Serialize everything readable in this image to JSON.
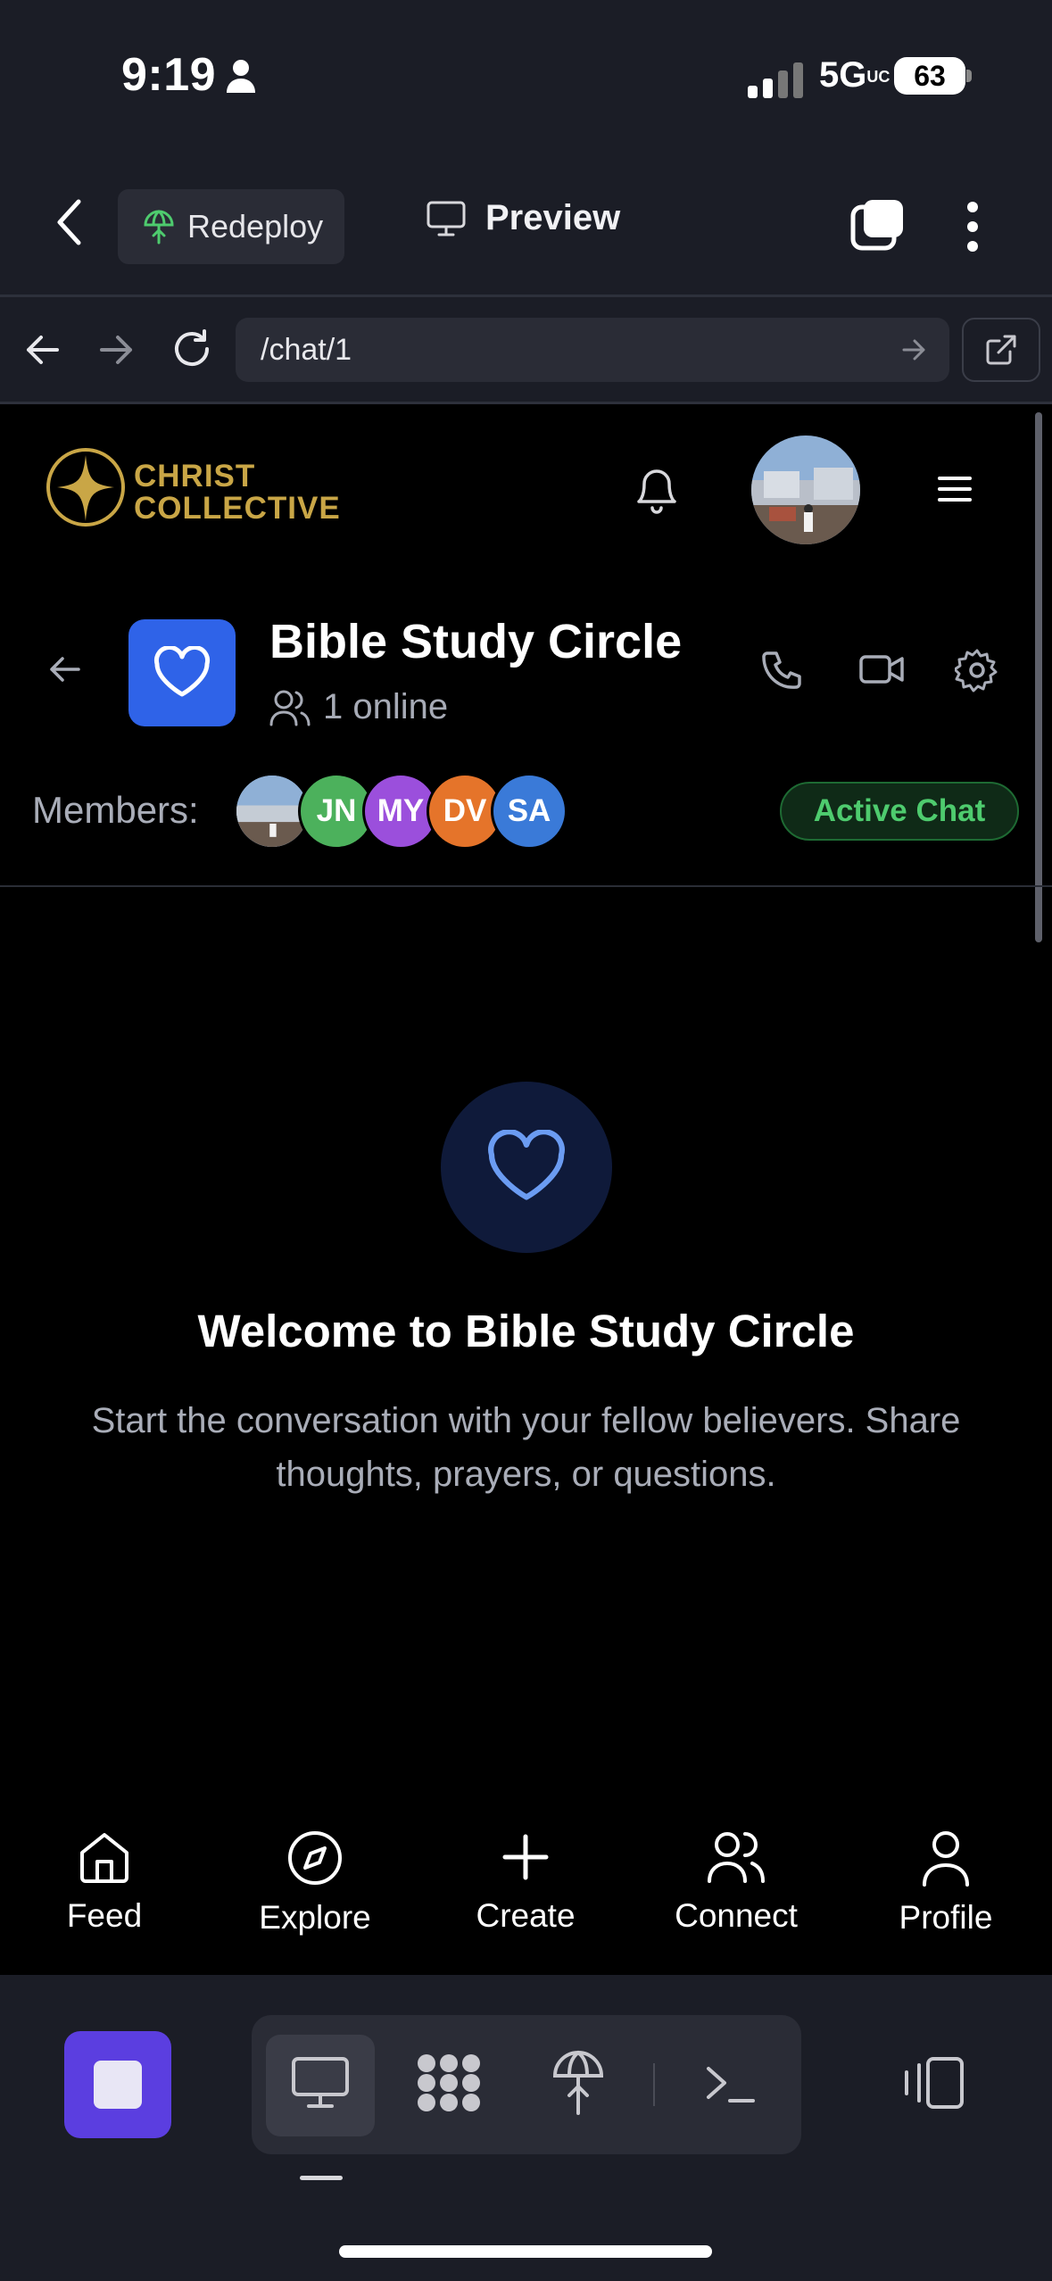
{
  "status_bar": {
    "time": "9:19",
    "network": "5G",
    "network_suffix": "UC",
    "battery": "63"
  },
  "app_bar": {
    "redeploy_label": "Redeploy",
    "preview_label": "Preview"
  },
  "url_bar": {
    "url": "/chat/1"
  },
  "site": {
    "logo_line1": "CHRIST",
    "logo_line2": "COLLECTIVE"
  },
  "chat": {
    "title": "Bible Study Circle",
    "online_text": "1 online",
    "members_label": "Members:",
    "members": [
      {
        "initials": "JN",
        "color": "#4cb15c"
      },
      {
        "initials": "MY",
        "color": "#9b4fdc"
      },
      {
        "initials": "DV",
        "color": "#e5742a"
      },
      {
        "initials": "SA",
        "color": "#3a7ad8"
      }
    ],
    "status_badge": "Active Chat",
    "welcome_title": "Welcome to Bible Study Circle",
    "welcome_sub": "Start the conversation with your fellow believers. Share thoughts, prayers, or questions."
  },
  "bottom_nav": {
    "items": [
      {
        "label": "Feed",
        "icon": "home-icon"
      },
      {
        "label": "Explore",
        "icon": "compass-icon"
      },
      {
        "label": "Create",
        "icon": "plus-icon"
      },
      {
        "label": "Connect",
        "icon": "users-icon"
      },
      {
        "label": "Profile",
        "icon": "user-icon"
      }
    ]
  },
  "colors": {
    "accent": "#2f63e8",
    "brand_gold": "#c9a646",
    "active_green": "#4ecb6e",
    "dock_purple": "#5b3ee0"
  }
}
